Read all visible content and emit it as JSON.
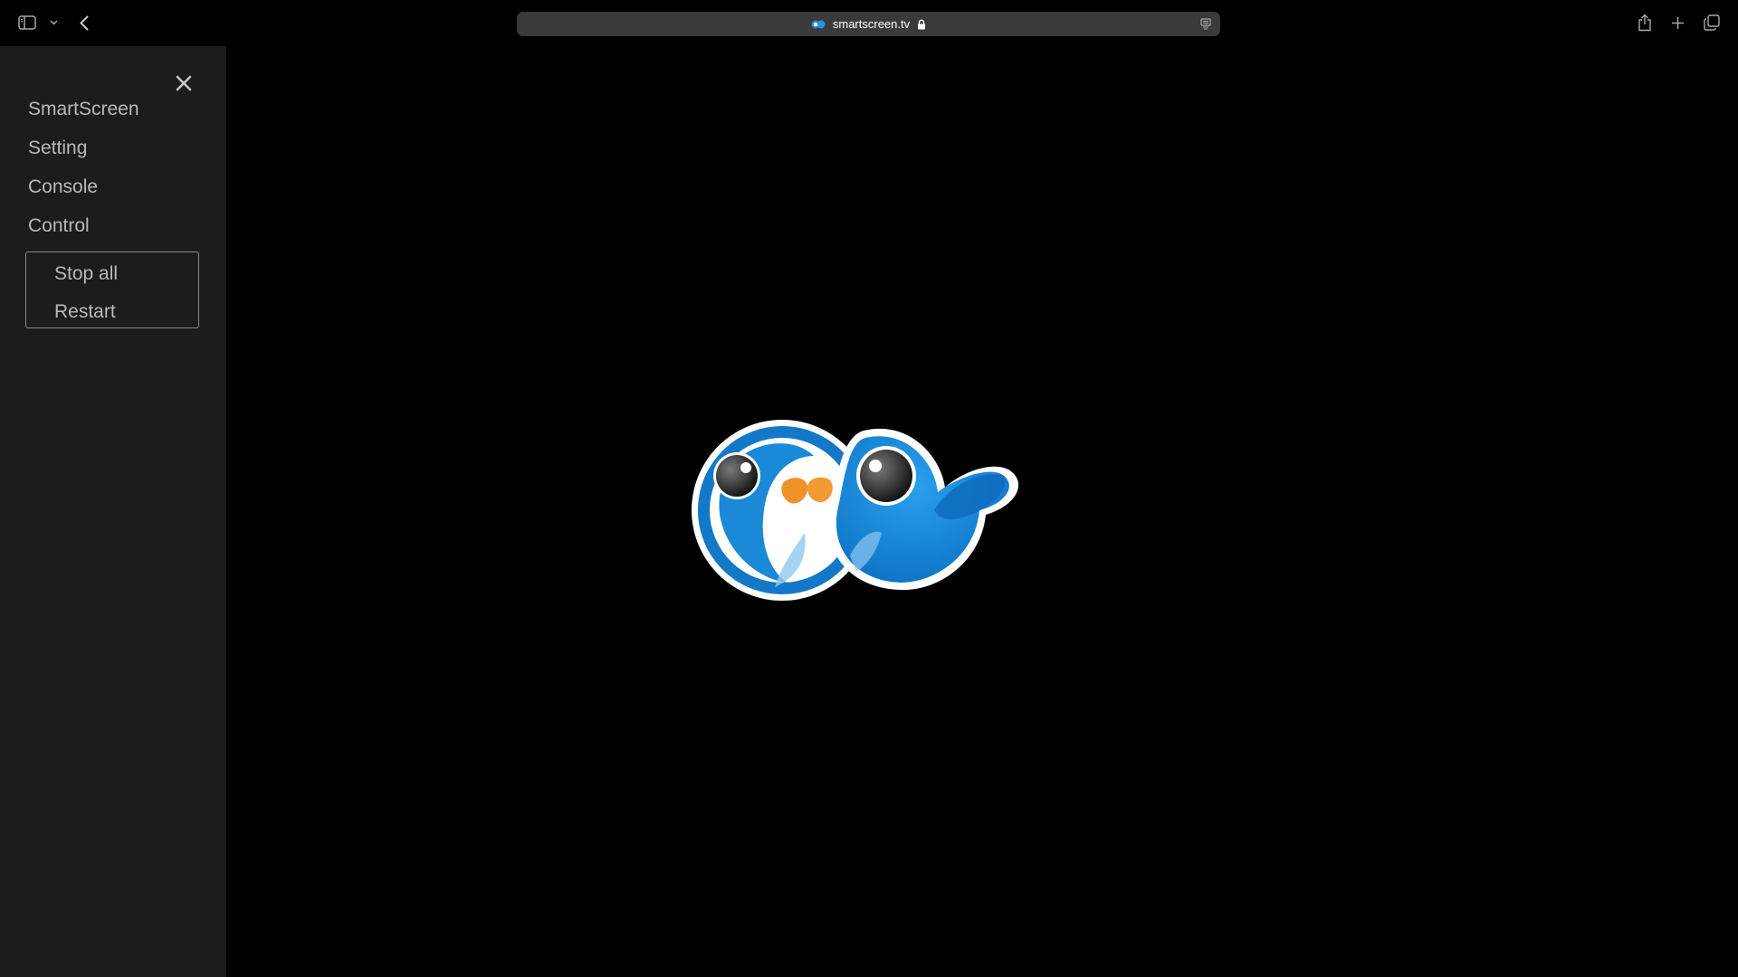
{
  "browser": {
    "address": "smartscreen.tv",
    "icons": {
      "sidebar_toggle": "sidebar-icon",
      "sidebar_menu": "chevron-down-icon",
      "back": "back-arrow-icon",
      "lock": "lock-icon",
      "reader": "reader-icon",
      "share": "share-icon",
      "new_tab": "plus-icon",
      "tabs_overview": "tabs-icon"
    }
  },
  "sidebar": {
    "close": "close-icon",
    "items": [
      {
        "label": "SmartScreen"
      },
      {
        "label": "Setting"
      },
      {
        "label": "Console"
      },
      {
        "label": "Control"
      }
    ],
    "control_submenu": [
      {
        "label": "Stop all"
      },
      {
        "label": "Restart"
      }
    ]
  },
  "colors": {
    "page_background": "#000000",
    "sidebar_background": "#1c1c1c",
    "menu_text": "#b9b9b9",
    "logo_blue": "#1a8ad8",
    "logo_beak": "#f0922a"
  }
}
